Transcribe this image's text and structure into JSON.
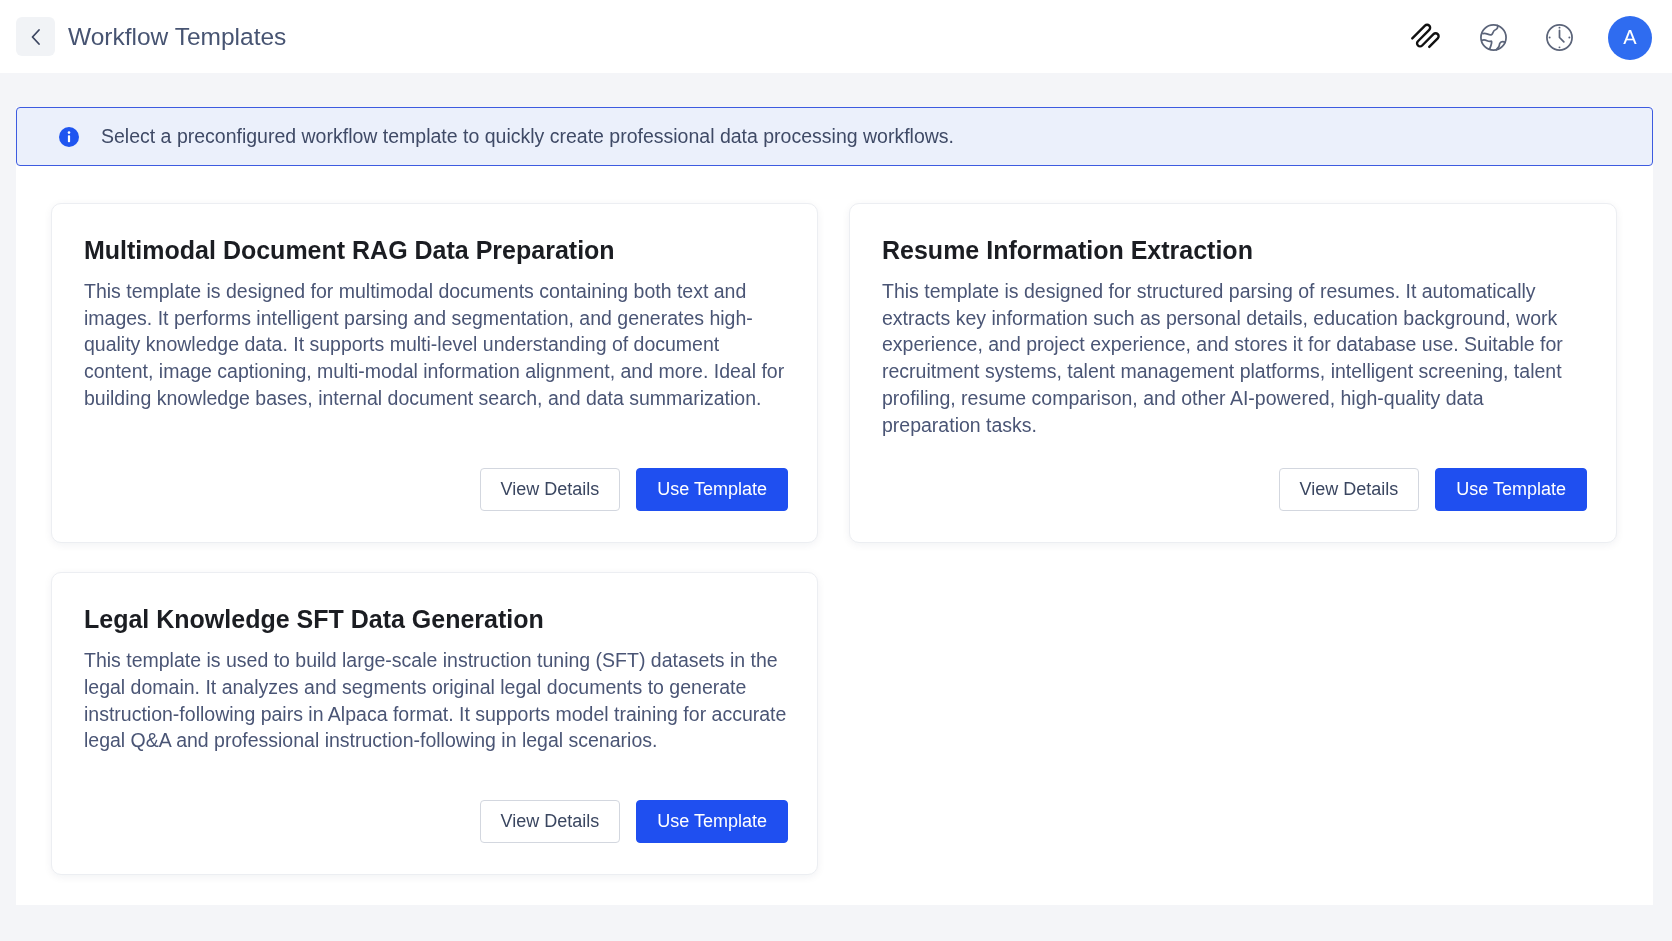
{
  "header": {
    "title": "Workflow Templates",
    "avatar_initial": "A"
  },
  "info_banner": {
    "text": "Select a preconfigured workflow template to quickly create professional data processing workflows."
  },
  "templates": [
    {
      "title": "Multimodal Document RAG Data Preparation",
      "description": "This template is designed for multimodal documents containing both text and images. It performs intelligent parsing and segmentation, and generates high-quality knowledge data. It supports multi-level understanding of document content, image captioning, multi-modal information alignment, and more. Ideal for building knowledge bases, internal document search, and data summarization.",
      "buttons": [
        {
          "label": "View Details",
          "kind": "secondary"
        },
        {
          "label": "Use Template",
          "kind": "primary"
        }
      ]
    },
    {
      "title": "Resume Information Extraction",
      "description": "This template is designed for structured parsing of resumes. It automatically extracts key information such as personal details, education background, work experience, and project experience, and stores it for database use. Suitable for recruitment systems, talent management platforms, intelligent screening, talent profiling, resume comparison, and other AI-powered, high-quality data preparation tasks.",
      "buttons": [
        {
          "label": "View Details",
          "kind": "secondary"
        },
        {
          "label": "Use Template",
          "kind": "primary"
        }
      ]
    },
    {
      "title": "Legal Knowledge SFT Data Generation",
      "description": "This template is used to build large-scale instruction tuning (SFT) datasets in the legal domain. It analyzes and segments original legal documents to generate instruction-following pairs in Alpaca format. It supports model training for accurate legal Q&A and professional instruction-following in legal scenarios.",
      "buttons": [
        {
          "label": "View Details",
          "kind": "secondary"
        },
        {
          "label": "Use Template",
          "kind": "primary"
        }
      ]
    }
  ]
}
